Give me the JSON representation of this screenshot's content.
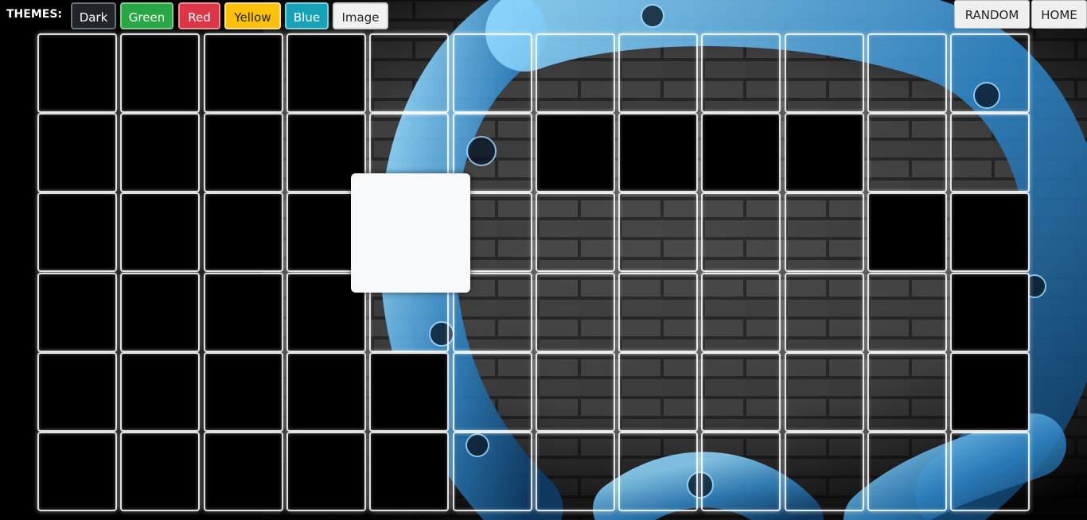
{
  "themes": {
    "label": "THEMES:",
    "buttons": [
      {
        "key": "dark",
        "label": "Dark",
        "color": "#212529"
      },
      {
        "key": "green",
        "label": "Green",
        "color": "#28a745"
      },
      {
        "key": "red",
        "label": "Red",
        "color": "#dc3545"
      },
      {
        "key": "yellow",
        "label": "Yellow",
        "color": "#ffc107"
      },
      {
        "key": "blue",
        "label": "Blue",
        "color": "#17a2b8"
      },
      {
        "key": "image",
        "label": "Image",
        "color": "#f1f1f1"
      }
    ]
  },
  "nav": {
    "random_label": "RANDOM",
    "home_label": "HOME"
  },
  "grid": {
    "rows": 6,
    "cols": 12,
    "cells": [
      "dark",
      "dark",
      "dark",
      "dark",
      "clear",
      "clear",
      "clear",
      "clear",
      "clear",
      "clear",
      "clear",
      "clear",
      "dark",
      "dark",
      "dark",
      "dark",
      "clear",
      "clear",
      "dark",
      "dark",
      "dark",
      "dark",
      "clear",
      "clear",
      "dark",
      "dark",
      "dark",
      "dark",
      "clear",
      "clear",
      "clear",
      "clear",
      "clear",
      "clear",
      "dark",
      "dark",
      "dark",
      "dark",
      "dark",
      "dark",
      "clear",
      "clear",
      "clear",
      "clear",
      "clear",
      "clear",
      "clear",
      "dark",
      "dark",
      "dark",
      "dark",
      "dark",
      "dark",
      "clear",
      "clear",
      "clear",
      "clear",
      "clear",
      "clear",
      "dark",
      "dark",
      "dark",
      "dark",
      "dark",
      "dark",
      "clear",
      "clear",
      "clear",
      "clear",
      "clear",
      "clear",
      "clear"
    ]
  },
  "colors": {
    "background": "#000000",
    "accent_blue": "#2fa8e8",
    "brick": "#3a3a3a",
    "cell_border": "#ffffff",
    "floating_tile": "#f8f9fa"
  },
  "background_image": "brick-wall-with-blue-boombox-ring"
}
